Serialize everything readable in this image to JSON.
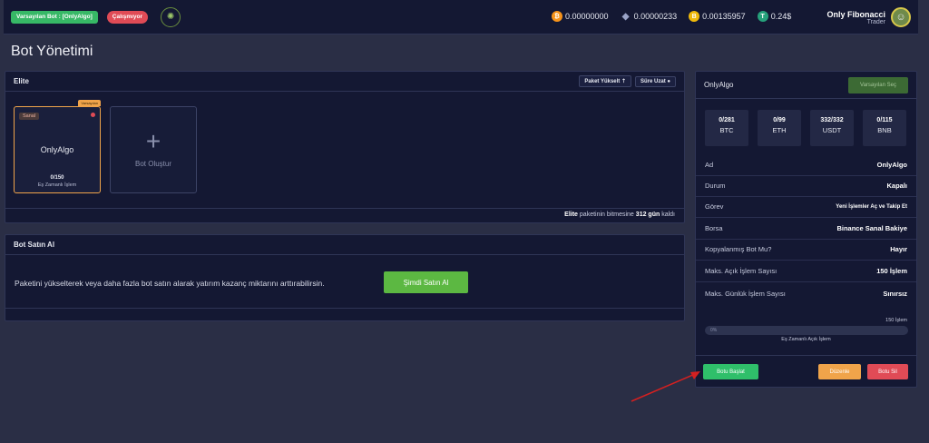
{
  "topbar": {
    "default_bot": "Varsayılan Bot : [OnlyAlgo]",
    "status": "Çalışmıyor",
    "balances": [
      {
        "icon": "btc-coin-icon",
        "symbol": "₿",
        "value": "0.00000000"
      },
      {
        "icon": "eth-coin-icon",
        "symbol": "◆",
        "value": "0.00000233"
      },
      {
        "icon": "bnb-coin-icon",
        "symbol": "B",
        "value": "0.00135957"
      },
      {
        "icon": "usdt-coin-icon",
        "symbol": "T",
        "value": "0.24$"
      }
    ],
    "user": {
      "name": "Only Fibonacci",
      "role": "Trader"
    }
  },
  "page_title": "Bot Yönetimi",
  "elite": {
    "title": "Elite",
    "upgrade_label": "Paket Yükselt",
    "extend_label": "Süre Uzat",
    "bot_card": {
      "badge": "Varsayılan",
      "tag": "Sanal",
      "name": "OnlyAlgo",
      "count": "0/150",
      "sub": "Eş Zamanlı İşlem"
    },
    "create_label": "Bot Oluştur",
    "footnote_pkg": "Elite",
    "footnote_mid": "paketinin bitmesine",
    "footnote_days": "312 gün",
    "footnote_end": "kaldı"
  },
  "buy": {
    "title": "Bot Satın Al",
    "text": "Paketini yükselterek veya daha fazla bot satın alarak yatırım kazanç miktarını arttırabilirsin.",
    "button": "Şimdi Satın Al"
  },
  "detail": {
    "title": "OnlyAlgo",
    "default_button": "Varsayılan Seç",
    "stats": [
      {
        "value": "0/281",
        "label": "BTC"
      },
      {
        "value": "0/99",
        "label": "ETH"
      },
      {
        "value": "332/332",
        "label": "USDT"
      },
      {
        "value": "0/115",
        "label": "BNB"
      }
    ],
    "rows": [
      {
        "label": "Ad",
        "value": "OnlyAlgo"
      },
      {
        "label": "Durum",
        "value": "Kapalı"
      },
      {
        "label": "Görev",
        "value": "Yeni İşlemler Aç ve Takip Et"
      },
      {
        "label": "Borsa",
        "value": "Binance Sanal Bakiye"
      },
      {
        "label": "Kopyalanmış Bot Mu?",
        "value": "Hayır"
      },
      {
        "label": "Maks. Açık İşlem Sayısı",
        "value": "150 İşlem"
      },
      {
        "label": "Maks. Günlük İşlem Sayısı",
        "value": "Sınırsız"
      }
    ],
    "progress": {
      "max_label": "150 İşlem",
      "percent_text": "0%",
      "fraction": 0,
      "caption": "Eş Zamanlı Açık İşlem"
    },
    "start_button": "Botu Başlat",
    "edit_button": "Düzenle",
    "delete_button": "Botu Sil"
  },
  "colors": {
    "accent_green": "#5cb842",
    "danger": "#e04b56",
    "warning": "#f0a44a",
    "annotation_arrow": "#d42020"
  }
}
